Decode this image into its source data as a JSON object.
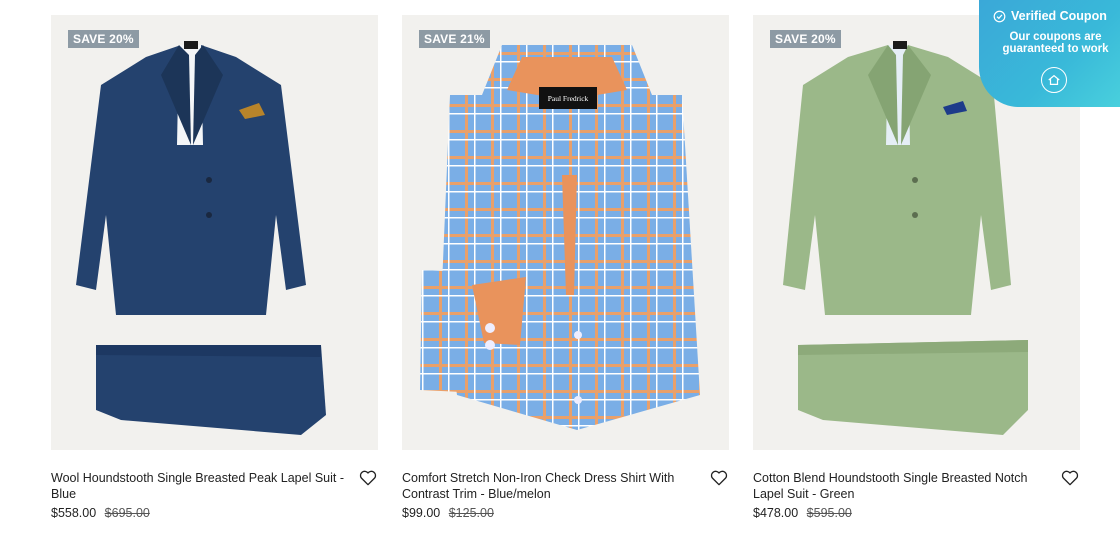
{
  "products": [
    {
      "badge": "SAVE 20%",
      "title": "Wool Houndstooth Single Breasted Peak Lapel Suit - Blue",
      "price": "$558.00",
      "original_price": "$695.00",
      "image": "navy-suit",
      "color": "#24426e"
    },
    {
      "badge": "SAVE 21%",
      "title": "Comfort Stretch Non-Iron Check Dress Shirt With Contrast Trim - Blue/melon",
      "price": "$99.00",
      "original_price": "$125.00",
      "image": "check-dress-shirt",
      "color": "#7aaee6",
      "label_text": "Paul Fredrick"
    },
    {
      "badge": "SAVE 20%",
      "title": "Cotton Blend Houndstooth Single Breasted Notch Lapel Suit - Green",
      "price": "$478.00",
      "original_price": "$595.00",
      "image": "green-suit",
      "color": "#9bb889"
    }
  ],
  "coupon": {
    "title": "Verified Coupon",
    "subtitle": "Our coupons are guaranteed to work",
    "icons": [
      "check-circle-icon",
      "home-icon"
    ]
  },
  "icons": {
    "wishlist": "heart-icon"
  }
}
